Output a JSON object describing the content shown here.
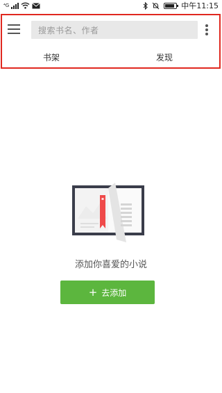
{
  "status_bar": {
    "carrier_label": "⁴G",
    "time": "中午11:15",
    "battery_level": 0.85
  },
  "toolbar": {
    "search_placeholder": "搜索书名、作者",
    "tabs": [
      {
        "label": "书架"
      },
      {
        "label": "发现"
      }
    ]
  },
  "empty_state": {
    "message": "添加你喜爱的小说",
    "add_button_label": "去添加",
    "add_button_icon": "plus-icon"
  },
  "colors": {
    "highlight_border": "#e0281f",
    "button_green": "#5cb63e",
    "bookmark_red": "#ef4a4a"
  }
}
